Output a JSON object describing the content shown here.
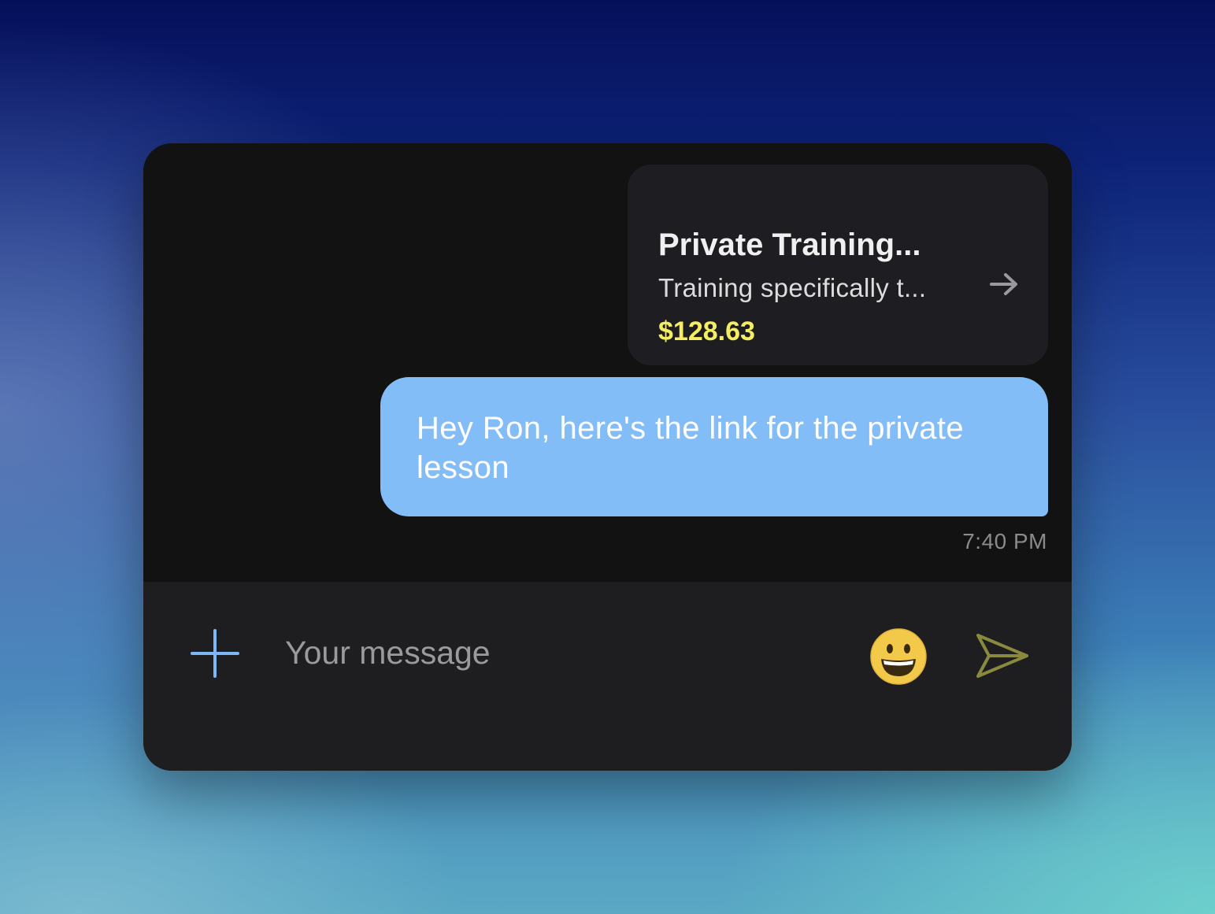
{
  "product_card": {
    "title": "Private Training...",
    "description": "Training specifically t...",
    "price": "$128.63",
    "icon": "arrow-right-icon"
  },
  "message": {
    "text": "Hey Ron, here's the link for the private lesson",
    "timestamp": "7:40 PM"
  },
  "composer": {
    "placeholder": "Your message",
    "value": "",
    "icons": [
      "plus-icon",
      "emoji-icon",
      "send-icon"
    ]
  },
  "colors": {
    "bubble": "#83bdf8",
    "price": "#f6ee62",
    "accent_plus": "#7cb8f5",
    "send": "#8a8a3e",
    "panel": "#121212",
    "composer": "#1e1e21"
  }
}
